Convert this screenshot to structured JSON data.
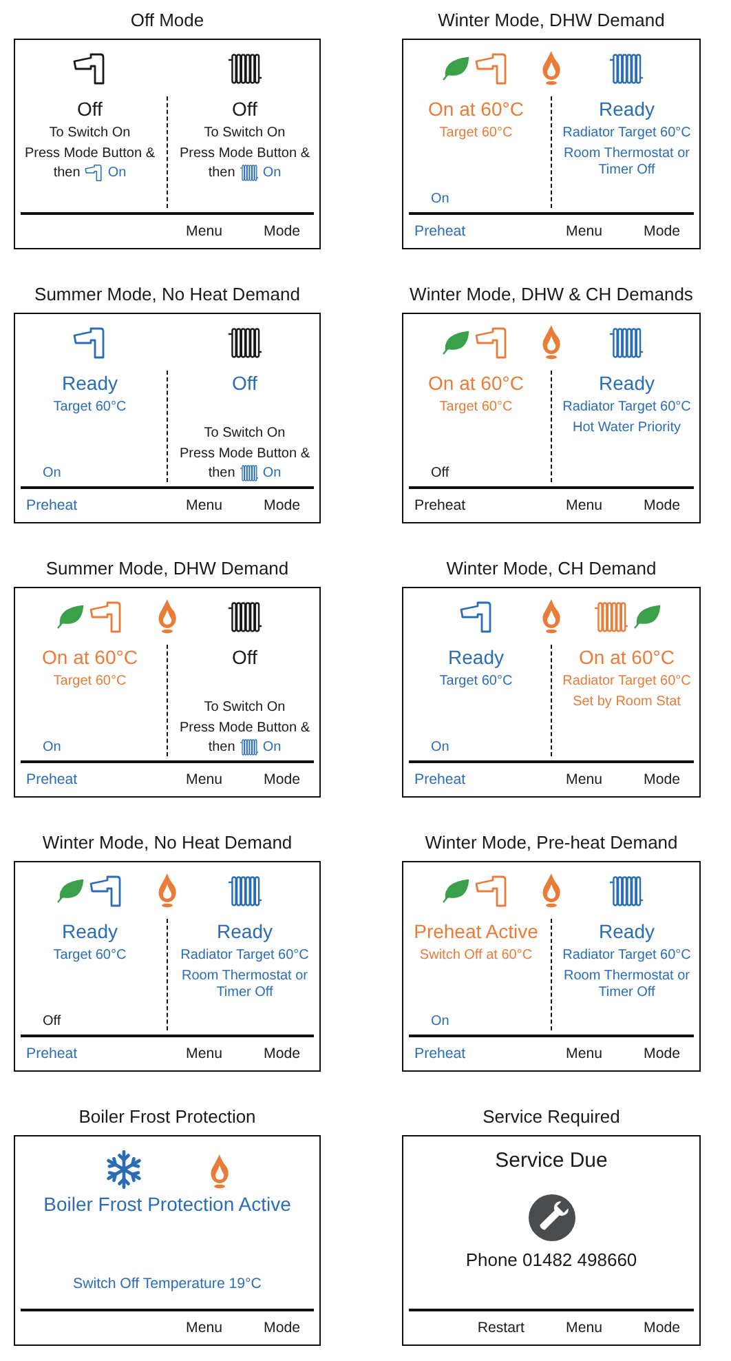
{
  "panels": [
    {
      "caption": "Off Mode",
      "kind": "split",
      "flame": false,
      "left": {
        "leaf": false,
        "color": "#1a1a1a",
        "status": {
          "text": "Off",
          "color": "#1a1a1a"
        },
        "lines": [
          {
            "kind": "text",
            "color": "#1a1a1a",
            "text": "To Switch On"
          },
          {
            "kind": "text",
            "color": "#1a1a1a",
            "text": "Press Mode Button &"
          },
          {
            "kind": "instruction",
            "prefix": "then",
            "suffix": "On"
          }
        ]
      },
      "right": {
        "leaf": false,
        "color": "#1a1a1a",
        "status": {
          "text": "Off",
          "color": "#1a1a1a"
        },
        "lines": [
          {
            "kind": "text",
            "color": "#1a1a1a",
            "text": "To Switch On"
          },
          {
            "kind": "text",
            "color": "#1a1a1a",
            "text": "Press Mode Button &"
          },
          {
            "kind": "instruction",
            "prefix": "then",
            "suffix": "On"
          }
        ]
      },
      "footer": {
        "right": [
          {
            "label": "Menu",
            "color": "#1a1a1a"
          },
          {
            "label": "Mode",
            "color": "#1a1a1a"
          }
        ]
      }
    },
    {
      "caption": "Winter Mode, DHW Demand",
      "kind": "split",
      "flame": true,
      "left": {
        "leaf": true,
        "color": "#ea7c3a",
        "status": {
          "text": "On at 60°C",
          "color": "#ea7c3a"
        },
        "lines": [
          {
            "kind": "text",
            "color": "#ea7c3a",
            "text": "Target 60°C"
          }
        ],
        "note": {
          "text": "On",
          "color": "#2a6db5"
        }
      },
      "right": {
        "leaf": false,
        "color": "#2a6db5",
        "status": {
          "text": "Ready",
          "color": "#2a6db5"
        },
        "lines": [
          {
            "kind": "text",
            "color": "#2a6db5",
            "text": "Radiator Target 60°C"
          },
          {
            "kind": "text",
            "color": "#2a6db5",
            "text": "Room Thermostat or Timer Off"
          }
        ]
      },
      "footer": {
        "left": [
          {
            "label": "Preheat",
            "color": "#2a6db5"
          }
        ],
        "right": [
          {
            "label": "Menu",
            "color": "#1a1a1a"
          },
          {
            "label": "Mode",
            "color": "#1a1a1a"
          }
        ]
      }
    },
    {
      "caption": "Summer Mode, No Heat Demand",
      "kind": "split",
      "flame": false,
      "left": {
        "leaf": false,
        "color": "#2a6db5",
        "status": {
          "text": "Ready",
          "color": "#2a6db5"
        },
        "lines": [
          {
            "kind": "text",
            "color": "#2a6db5",
            "text": "Target 60°C"
          }
        ],
        "note": {
          "text": "On",
          "color": "#2a6db5"
        }
      },
      "right": {
        "leaf": false,
        "color": "#1a1a1a",
        "status": {
          "text": "Off",
          "color": "#2a6db5"
        },
        "hint": [
          {
            "kind": "text",
            "color": "#1a1a1a",
            "text": "To Switch On"
          },
          {
            "kind": "text",
            "color": "#1a1a1a",
            "text": "Press Mode Button &"
          },
          {
            "kind": "instruction",
            "prefix": "then",
            "suffix": "On"
          }
        ]
      },
      "footer": {
        "left": [
          {
            "label": "Preheat",
            "color": "#2a6db5"
          }
        ],
        "right": [
          {
            "label": "Menu",
            "color": "#1a1a1a"
          },
          {
            "label": "Mode",
            "color": "#1a1a1a"
          }
        ]
      }
    },
    {
      "caption": "Winter Mode, DHW & CH Demands",
      "kind": "split",
      "flame": true,
      "left": {
        "leaf": true,
        "color": "#ea7c3a",
        "status": {
          "text": "On at 60°C",
          "color": "#ea7c3a"
        },
        "lines": [
          {
            "kind": "text",
            "color": "#ea7c3a",
            "text": "Target 60°C"
          }
        ],
        "note": {
          "text": "Off",
          "color": "#1a1a1a"
        }
      },
      "right": {
        "leaf": false,
        "color": "#2a6db5",
        "status": {
          "text": "Ready",
          "color": "#2a6db5"
        },
        "lines": [
          {
            "kind": "text",
            "color": "#2a6db5",
            "text": "Radiator Target 60°C"
          },
          {
            "kind": "text",
            "color": "#2a6db5",
            "text": "Hot Water Priority"
          }
        ]
      },
      "footer": {
        "left": [
          {
            "label": "Preheat",
            "color": "#1a1a1a"
          }
        ],
        "right": [
          {
            "label": "Menu",
            "color": "#1a1a1a"
          },
          {
            "label": "Mode",
            "color": "#1a1a1a"
          }
        ]
      }
    },
    {
      "caption": "Summer Mode, DHW Demand",
      "kind": "split",
      "flame": true,
      "left": {
        "leaf": true,
        "color": "#ea7c3a",
        "status": {
          "text": "On at 60°C",
          "color": "#ea7c3a"
        },
        "lines": [
          {
            "kind": "text",
            "color": "#ea7c3a",
            "text": "Target 60°C"
          }
        ],
        "note": {
          "text": "On",
          "color": "#2a6db5"
        }
      },
      "right": {
        "leaf": false,
        "color": "#1a1a1a",
        "status": {
          "text": "Off",
          "color": "#1a1a1a"
        },
        "hint": [
          {
            "kind": "text",
            "color": "#1a1a1a",
            "text": "To Switch On"
          },
          {
            "kind": "text",
            "color": "#1a1a1a",
            "text": "Press Mode Button &"
          },
          {
            "kind": "instruction",
            "prefix": "then",
            "suffix": "On"
          }
        ]
      },
      "footer": {
        "left": [
          {
            "label": "Preheat",
            "color": "#2a6db5"
          }
        ],
        "right": [
          {
            "label": "Menu",
            "color": "#1a1a1a"
          },
          {
            "label": "Mode",
            "color": "#1a1a1a"
          }
        ]
      }
    },
    {
      "caption": "Winter Mode, CH Demand",
      "kind": "split",
      "flame": true,
      "left": {
        "leaf": false,
        "color": "#2a6db5",
        "status": {
          "text": "Ready",
          "color": "#2a6db5"
        },
        "lines": [
          {
            "kind": "text",
            "color": "#2a6db5",
            "text": "Target 60°C"
          }
        ],
        "note": {
          "text": "On",
          "color": "#2a6db5"
        }
      },
      "right": {
        "leaf": true,
        "color": "#ea7c3a",
        "status": {
          "text": "On at 60°C",
          "color": "#ea7c3a"
        },
        "lines": [
          {
            "kind": "text",
            "color": "#ea7c3a",
            "text": "Radiator Target 60°C"
          },
          {
            "kind": "text",
            "color": "#ea7c3a",
            "text": "Set by Room Stat"
          }
        ]
      },
      "footer": {
        "left": [
          {
            "label": "Preheat",
            "color": "#2a6db5"
          }
        ],
        "right": [
          {
            "label": "Menu",
            "color": "#1a1a1a"
          },
          {
            "label": "Mode",
            "color": "#1a1a1a"
          }
        ]
      }
    },
    {
      "caption": "Winter Mode, No Heat Demand",
      "kind": "split",
      "flame": true,
      "left": {
        "leaf": true,
        "color": "#2a6db5",
        "status": {
          "text": "Ready",
          "color": "#2a6db5"
        },
        "lines": [
          {
            "kind": "text",
            "color": "#2a6db5",
            "text": "Target 60°C"
          }
        ],
        "note": {
          "text": "Off",
          "color": "#1a1a1a"
        }
      },
      "right": {
        "leaf": false,
        "color": "#2a6db5",
        "status": {
          "text": "Ready",
          "color": "#2a6db5"
        },
        "lines": [
          {
            "kind": "text",
            "color": "#2a6db5",
            "text": "Radiator Target 60°C"
          },
          {
            "kind": "text",
            "color": "#2a6db5",
            "text": "Room Thermostat or Timer Off"
          }
        ]
      },
      "footer": {
        "left": [
          {
            "label": "Preheat",
            "color": "#2a6db5"
          }
        ],
        "right": [
          {
            "label": "Menu",
            "color": "#1a1a1a"
          },
          {
            "label": "Mode",
            "color": "#1a1a1a"
          }
        ]
      }
    },
    {
      "caption": "Winter Mode, Pre-heat Demand",
      "kind": "split",
      "flame": true,
      "left": {
        "leaf": true,
        "color": "#ea7c3a",
        "status": {
          "text": "Preheat Active",
          "color": "#ea7c3a"
        },
        "lines": [
          {
            "kind": "text",
            "color": "#ea7c3a",
            "text": "Switch Off at 60°C"
          }
        ],
        "note": {
          "text": "On",
          "color": "#2a6db5"
        }
      },
      "right": {
        "leaf": false,
        "color": "#2a6db5",
        "status": {
          "text": "Ready",
          "color": "#2a6db5"
        },
        "lines": [
          {
            "kind": "text",
            "color": "#2a6db5",
            "text": "Radiator Target 60°C"
          },
          {
            "kind": "text",
            "color": "#2a6db5",
            "text": "Room Thermostat or Timer Off"
          }
        ]
      },
      "footer": {
        "left": [
          {
            "label": "Preheat",
            "color": "#2a6db5"
          }
        ],
        "right": [
          {
            "label": "Menu",
            "color": "#1a1a1a"
          },
          {
            "label": "Mode",
            "color": "#1a1a1a"
          }
        ]
      }
    },
    {
      "caption": "Boiler Frost Protection",
      "kind": "frost",
      "flame": true,
      "title": "Boiler Frost Protection Active",
      "note": "Switch Off Temperature 19°C",
      "footer": {
        "right": [
          {
            "label": "Menu",
            "color": "#1a1a1a"
          },
          {
            "label": "Mode",
            "color": "#1a1a1a"
          }
        ]
      }
    },
    {
      "caption": "Service Required",
      "kind": "service",
      "title": "Service Due",
      "note": "Phone 01482 498660",
      "footer": {
        "right": [
          {
            "label": "Restart",
            "color": "#1a1a1a"
          },
          {
            "label": "Menu",
            "color": "#1a1a1a"
          },
          {
            "label": "Mode",
            "color": "#1a1a1a"
          }
        ]
      }
    }
  ]
}
